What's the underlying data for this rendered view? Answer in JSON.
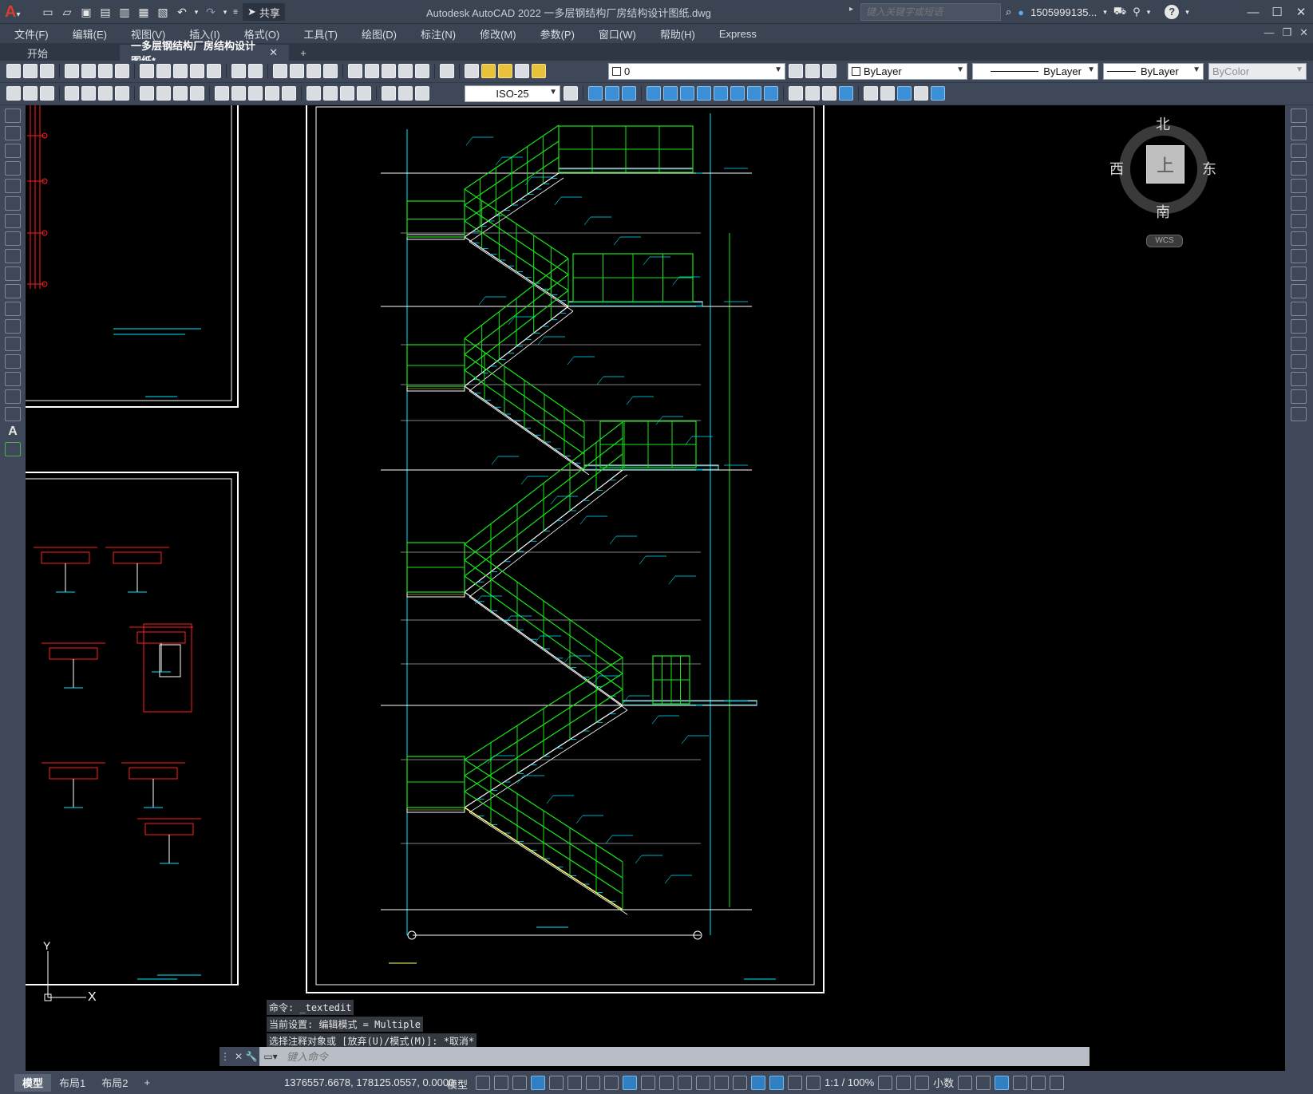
{
  "app": {
    "logo": "A",
    "title": "Autodesk AutoCAD 2022    一多层钢结构厂房结构设计图纸.dwg",
    "share_label": "共享",
    "search_placeholder": "键入关键字或短语",
    "user": "1505999135...",
    "help": "?"
  },
  "menu": [
    "文件(F)",
    "编辑(E)",
    "视图(V)",
    "插入(I)",
    "格式(O)",
    "工具(T)",
    "绘图(D)",
    "标注(N)",
    "修改(M)",
    "参数(P)",
    "窗口(W)",
    "帮助(H)",
    "Express"
  ],
  "tabs": {
    "start": "开始",
    "active": "一多层钢结构厂房结构设计图纸*",
    "close": "✕",
    "plus": "+"
  },
  "toolbar": {
    "layer_value": "0",
    "color_value": "ByLayer",
    "linetype_value": "ByLayer",
    "lineweight_value": "ByLayer",
    "plotstyle_value": "ByColor",
    "dimstyle_value": "ISO-25"
  },
  "viewcube": {
    "top_face": "上",
    "north": "北",
    "south": "南",
    "west": "西",
    "east": "东",
    "wcs": "WCS"
  },
  "command_history": [
    "命令: _textedit",
    "当前设置: 编辑模式 = Multiple",
    "选择注释对象或 [放弃(U)/模式(M)]: *取消*"
  ],
  "command_input_placeholder": "键入命令",
  "status": {
    "layout_tabs": [
      "模型",
      "布局1",
      "布局2"
    ],
    "add_tab": "+",
    "coordinates": "1376557.6678, 178125.0557, 0.0000",
    "space": "模型",
    "annotation_scale": "1:1 / 100%",
    "units": "小数"
  },
  "ucs": {
    "y_label": "Y",
    "x_label": "X"
  },
  "colors": {
    "drawing_bg": "#000000",
    "green": "#19e619",
    "cyan": "#00e5ff",
    "red": "#ff2020",
    "white": "#ffffff",
    "yellow": "#ffff66"
  }
}
